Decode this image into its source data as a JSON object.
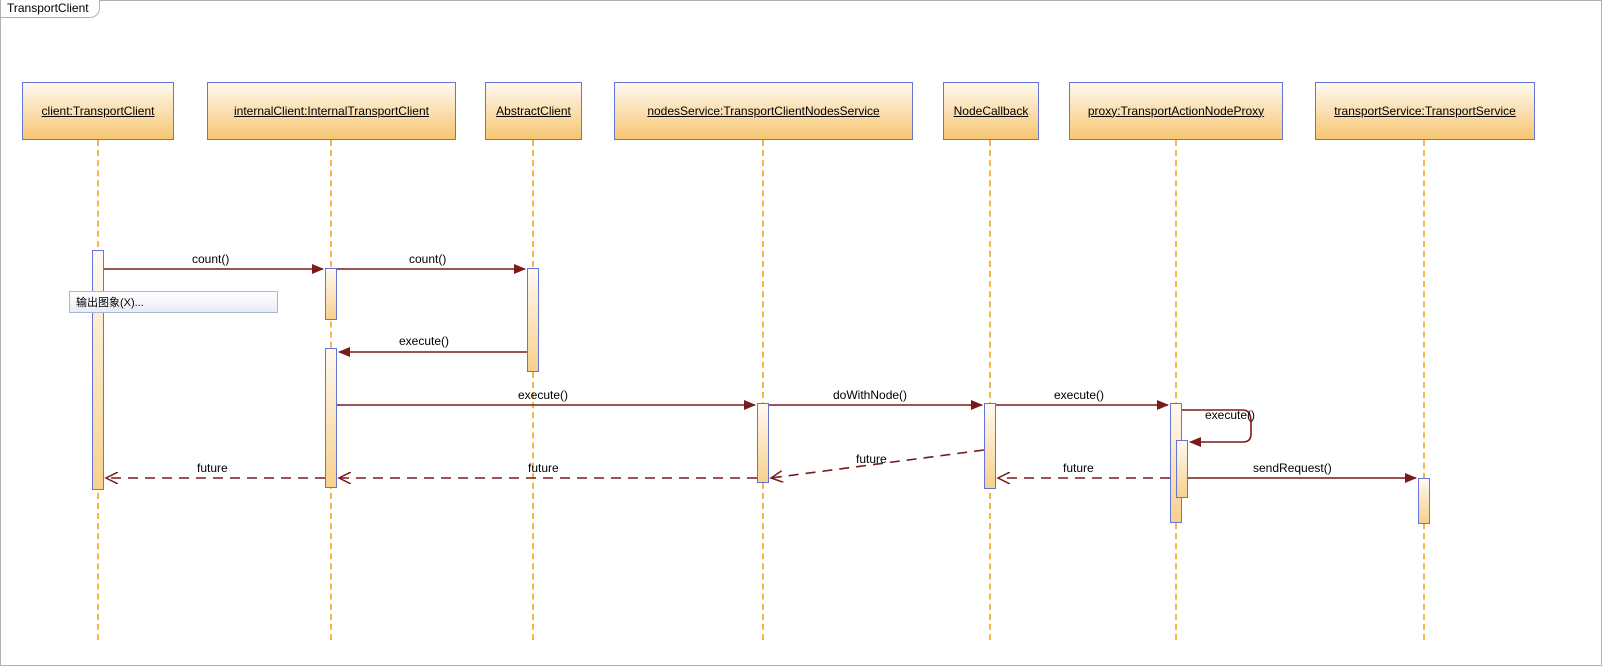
{
  "frame_title": "TransportClient",
  "participants": {
    "client": "client:TransportClient",
    "internalClient": "internalClient:InternalTransportClient",
    "abstractClient": "AbstractClient",
    "nodesService": "nodesService:TransportClientNodesService",
    "nodeCallback": "NodeCallback",
    "proxy": "proxy:TransportActionNodeProxy",
    "transportService": "transportService:TransportService"
  },
  "messages": {
    "count1": "count()",
    "count2": "count()",
    "executeUp": "execute()",
    "executeMain": "execute()",
    "doWithNode": "doWithNode()",
    "executeNode": "execute()",
    "executeSelf": "execute()",
    "sendRequest": "sendRequest()",
    "future1": "future",
    "future2": "future",
    "future3": "future",
    "future4": "future"
  },
  "context_menu_item": "输出图象(X)..."
}
